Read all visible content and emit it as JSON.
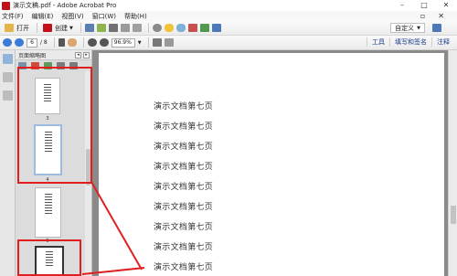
{
  "window": {
    "title": "演示文稿.pdf - Adobe Acrobat Pro",
    "minimize": "–",
    "maximize": "□",
    "close": "✕"
  },
  "menu": {
    "items": [
      "文件(F)",
      "编辑(E)",
      "视图(V)",
      "窗口(W)",
      "帮助(H)"
    ],
    "right_restore": "▫",
    "right_close": "✕"
  },
  "toolbar1": {
    "open_label": "打开",
    "create_label": "创建",
    "custom_label": "自定义"
  },
  "toolbar2": {
    "current_page": "6",
    "page_total": "/ 8",
    "zoom_value": "96.9%",
    "panes": [
      "工具",
      "填写和签名",
      "注释"
    ]
  },
  "panel": {
    "header": "页面缩略图",
    "thumbnails": [
      {
        "label": "3"
      },
      {
        "label": "4"
      },
      {
        "label": "5"
      },
      {
        "label": ""
      }
    ]
  },
  "document": {
    "lines": [
      "演示文档第七页",
      "演示文档第七页",
      "演示文档第七页",
      "演示文档第七页",
      "演示文档第七页",
      "演示文档第七页",
      "演示文档第七页",
      "演示文档第七页",
      "演示文档第七页"
    ]
  },
  "colors": {
    "highlight": "#e02020",
    "link": "#1a3c8c"
  }
}
